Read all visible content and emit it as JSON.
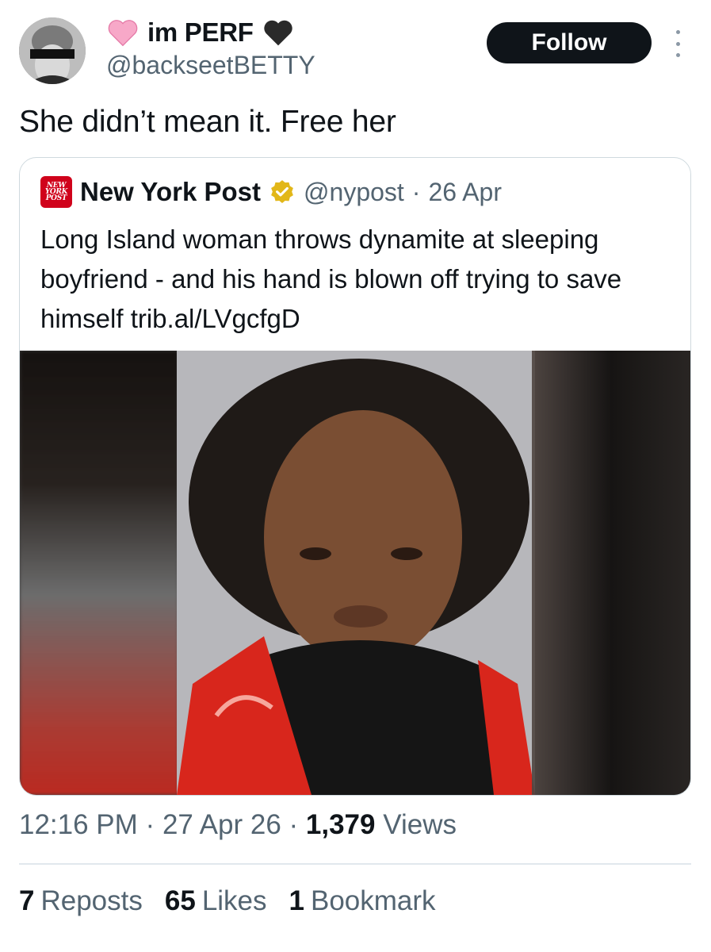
{
  "author": {
    "display_name": "im PERF",
    "handle": "@backseetBETTY",
    "name_emojis": [
      "pink-heart",
      "black-heart"
    ]
  },
  "actions": {
    "follow_label": "Follow"
  },
  "tweet": {
    "text": "She didn’t mean it. Free her"
  },
  "quoted_tweet": {
    "logo_lines": [
      "NEW",
      "YORK",
      "POST"
    ],
    "display_name": "New York Post",
    "handle": "@nypost",
    "separator": "·",
    "date": "26 Apr",
    "text": "Long Island woman throws dynamite at sleeping boyfriend - and his hand is blown off trying to save himself trib.al/LVgcfgD"
  },
  "meta": {
    "time": "12:16 PM",
    "sep1": "·",
    "date": "27 Apr 26",
    "sep2": "·",
    "views_count": "1,379",
    "views_label": "Views"
  },
  "stats": {
    "reposts_count": "7",
    "reposts_label": "Reposts",
    "likes_count": "65",
    "likes_label": "Likes",
    "bookmarks_count": "1",
    "bookmarks_label": "Bookmark"
  },
  "colors": {
    "text_primary": "#0f1419",
    "text_secondary": "#536471",
    "follow_bg": "#0f1419",
    "border": "#cfd9de",
    "nypost_red": "#d0021b",
    "verified_gold": "#e2b719",
    "pink_heart": "#f7a8c8"
  }
}
